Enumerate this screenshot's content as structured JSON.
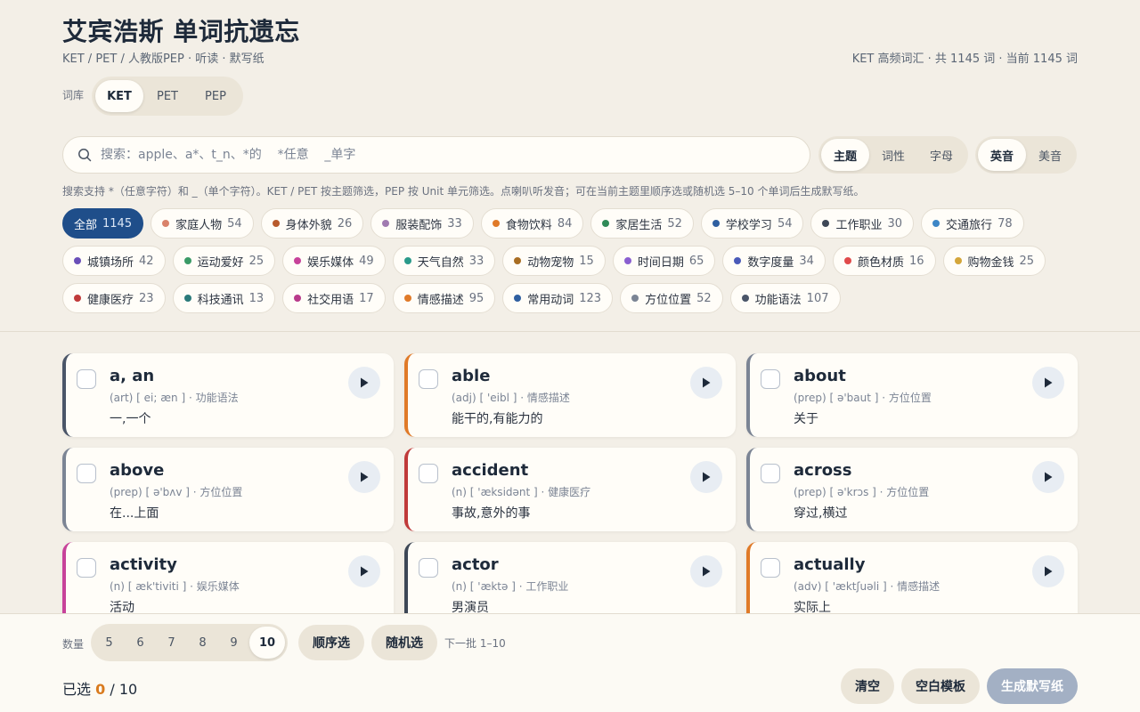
{
  "header": {
    "title": "艾宾浩斯 单词抗遗忘",
    "subtitle": "KET / PET / 人教版PEP · 听读 · 默写纸",
    "stats": "KET 高频词汇 · 共 1145 词 · 当前 1145 词"
  },
  "library": {
    "label": "词库",
    "options": [
      "KET",
      "PET",
      "PEP"
    ],
    "selected": "KET"
  },
  "search": {
    "placeholder": "搜索：apple、a*、t_n、*的    *任意    _单字",
    "value": ""
  },
  "mode": {
    "options": [
      "主题",
      "词性",
      "字母"
    ],
    "selected": "主题"
  },
  "accent": {
    "options": [
      "英音",
      "美音"
    ],
    "selected": "英音"
  },
  "hint": "搜索支持 *（任意字符）和 _（单个字符）。KET / PET 按主题筛选，PEP 按 Unit 单元筛选。点喇叭听发音；可在当前主题里顺序选或随机选 5–10 个单词后生成默写纸。",
  "topics": [
    [
      {
        "label": "全部",
        "count": "1145",
        "color": "",
        "active": true
      },
      {
        "label": "家庭人物",
        "count": "54",
        "color": "#d9826a"
      },
      {
        "label": "身体外貌",
        "count": "26",
        "color": "#b85a2c"
      },
      {
        "label": "服装配饰",
        "count": "33",
        "color": "#a07ab0"
      },
      {
        "label": "食物饮料",
        "count": "84",
        "color": "#e07a28"
      },
      {
        "label": "家居生活",
        "count": "52",
        "color": "#2f8a57"
      },
      {
        "label": "学校学习",
        "count": "54",
        "color": "#2f5fa0"
      },
      {
        "label": "工作职业",
        "count": "30",
        "color": "#3d4756"
      },
      {
        "label": "交通旅行",
        "count": "78",
        "color": "#3d86c6"
      }
    ],
    [
      {
        "label": "城镇场所",
        "count": "42",
        "color": "#6a4fb8"
      },
      {
        "label": "运动爱好",
        "count": "25",
        "color": "#3a9a66"
      },
      {
        "label": "娱乐媒体",
        "count": "49",
        "color": "#c7429a"
      },
      {
        "label": "天气自然",
        "count": "33",
        "color": "#2a9a8a"
      },
      {
        "label": "动物宠物",
        "count": "15",
        "color": "#a86d22"
      },
      {
        "label": "时间日期",
        "count": "65",
        "color": "#8a5fd0"
      },
      {
        "label": "数字度量",
        "count": "34",
        "color": "#4a5ab8"
      },
      {
        "label": "颜色材质",
        "count": "16",
        "color": "#e04a4a"
      },
      {
        "label": "购物金钱",
        "count": "25",
        "color": "#d4a63a"
      }
    ],
    [
      {
        "label": "健康医疗",
        "count": "23",
        "color": "#c03a3a"
      },
      {
        "label": "科技通讯",
        "count": "13",
        "color": "#2a7a7a"
      },
      {
        "label": "社交用语",
        "count": "17",
        "color": "#b83a8a"
      },
      {
        "label": "情感描述",
        "count": "95",
        "color": "#e07a28"
      },
      {
        "label": "常用动词",
        "count": "123",
        "color": "#2f5fa0"
      },
      {
        "label": "方位位置",
        "count": "52",
        "color": "#7b8494"
      },
      {
        "label": "功能语法",
        "count": "107",
        "color": "#4a5568"
      }
    ]
  ],
  "words": [
    {
      "word": "a, an",
      "meta": "(art) [ ei; æn ] · 功能语法",
      "meaning": "一,一个",
      "color": "#4a5568"
    },
    {
      "word": "able",
      "meta": "(adj) [ 'eibl ] · 情感描述",
      "meaning": "能干的,有能力的",
      "color": "#e07a28"
    },
    {
      "word": "about",
      "meta": "(prep) [ ə'baut ] · 方位位置",
      "meaning": "关于",
      "color": "#7b8494"
    },
    {
      "word": "above",
      "meta": "(prep) [ ə'bʌv ] · 方位位置",
      "meaning": "在...上面",
      "color": "#7b8494"
    },
    {
      "word": "accident",
      "meta": "(n) [ 'æksidənt ] · 健康医疗",
      "meaning": "事故,意外的事",
      "color": "#c03a3a"
    },
    {
      "word": "across",
      "meta": "(prep) [ ə'krɔs ] · 方位位置",
      "meaning": "穿过,横过",
      "color": "#7b8494"
    },
    {
      "word": "activity",
      "meta": "(n) [ æk'tiviti ] · 娱乐媒体",
      "meaning": "活动",
      "color": "#c7429a"
    },
    {
      "word": "actor",
      "meta": "(n) [ 'æktə ] · 工作职业",
      "meaning": "男演员",
      "color": "#3d4756"
    },
    {
      "word": "actually",
      "meta": "(adv) [ 'æktʃuəli ] · 情感描述",
      "meaning": "实际上",
      "color": "#e07a28"
    }
  ],
  "bottom": {
    "qty_label": "数量",
    "qty_options": [
      "5",
      "6",
      "7",
      "8",
      "9",
      "10"
    ],
    "qty_selected": "10",
    "sequential_label": "顺序选",
    "random_label": "随机选",
    "next_batch": "下一批 1–10",
    "selected_prefix": "已选",
    "selected_count": "0",
    "selected_suffix": "/ 10",
    "clear_label": "清空",
    "blank_label": "空白模板",
    "generate_label": "生成默写纸"
  }
}
